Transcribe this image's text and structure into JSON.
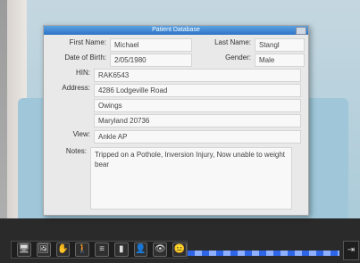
{
  "window": {
    "title": "Patient Database"
  },
  "patient": {
    "first_name_label": "First Name:",
    "first_name": "Michael",
    "last_name_label": "Last Name:",
    "last_name": "Stangl",
    "dob_label": "Date of Birth:",
    "dob": "2/05/1980",
    "gender_label": "Gender:",
    "gender": "Male",
    "hin_label": "HIN:",
    "hin": "RAK6543",
    "address_label": "Address:",
    "address_line1": "4286  Lodgeville Road",
    "address_line2": "Owings",
    "address_line3": "Maryland 20736",
    "view_label": "View:",
    "view": "Ankle AP",
    "notes_label": "Notes:",
    "notes": "Tripped on a Pothole, Inversion Injury, Now unable to weight bear"
  },
  "toolbar": {
    "items": [
      {
        "name": "monitor-icon",
        "glyph": "🖥"
      },
      {
        "name": "image-icon",
        "glyph": "🖼"
      },
      {
        "name": "hand-icon",
        "glyph": "✋"
      },
      {
        "name": "person-icon",
        "glyph": "🚶"
      },
      {
        "name": "menu-icon",
        "glyph": "≡"
      },
      {
        "name": "ruler-icon",
        "glyph": "▮"
      },
      {
        "name": "patient-icon",
        "glyph": "👤"
      },
      {
        "name": "eye-icon",
        "glyph": "👁"
      },
      {
        "name": "face-icon",
        "glyph": "😐"
      }
    ],
    "exit_glyph": "⇥"
  },
  "colors": {
    "title_blue": "#2e73c6",
    "stripe_blue": "#2f66e8"
  }
}
